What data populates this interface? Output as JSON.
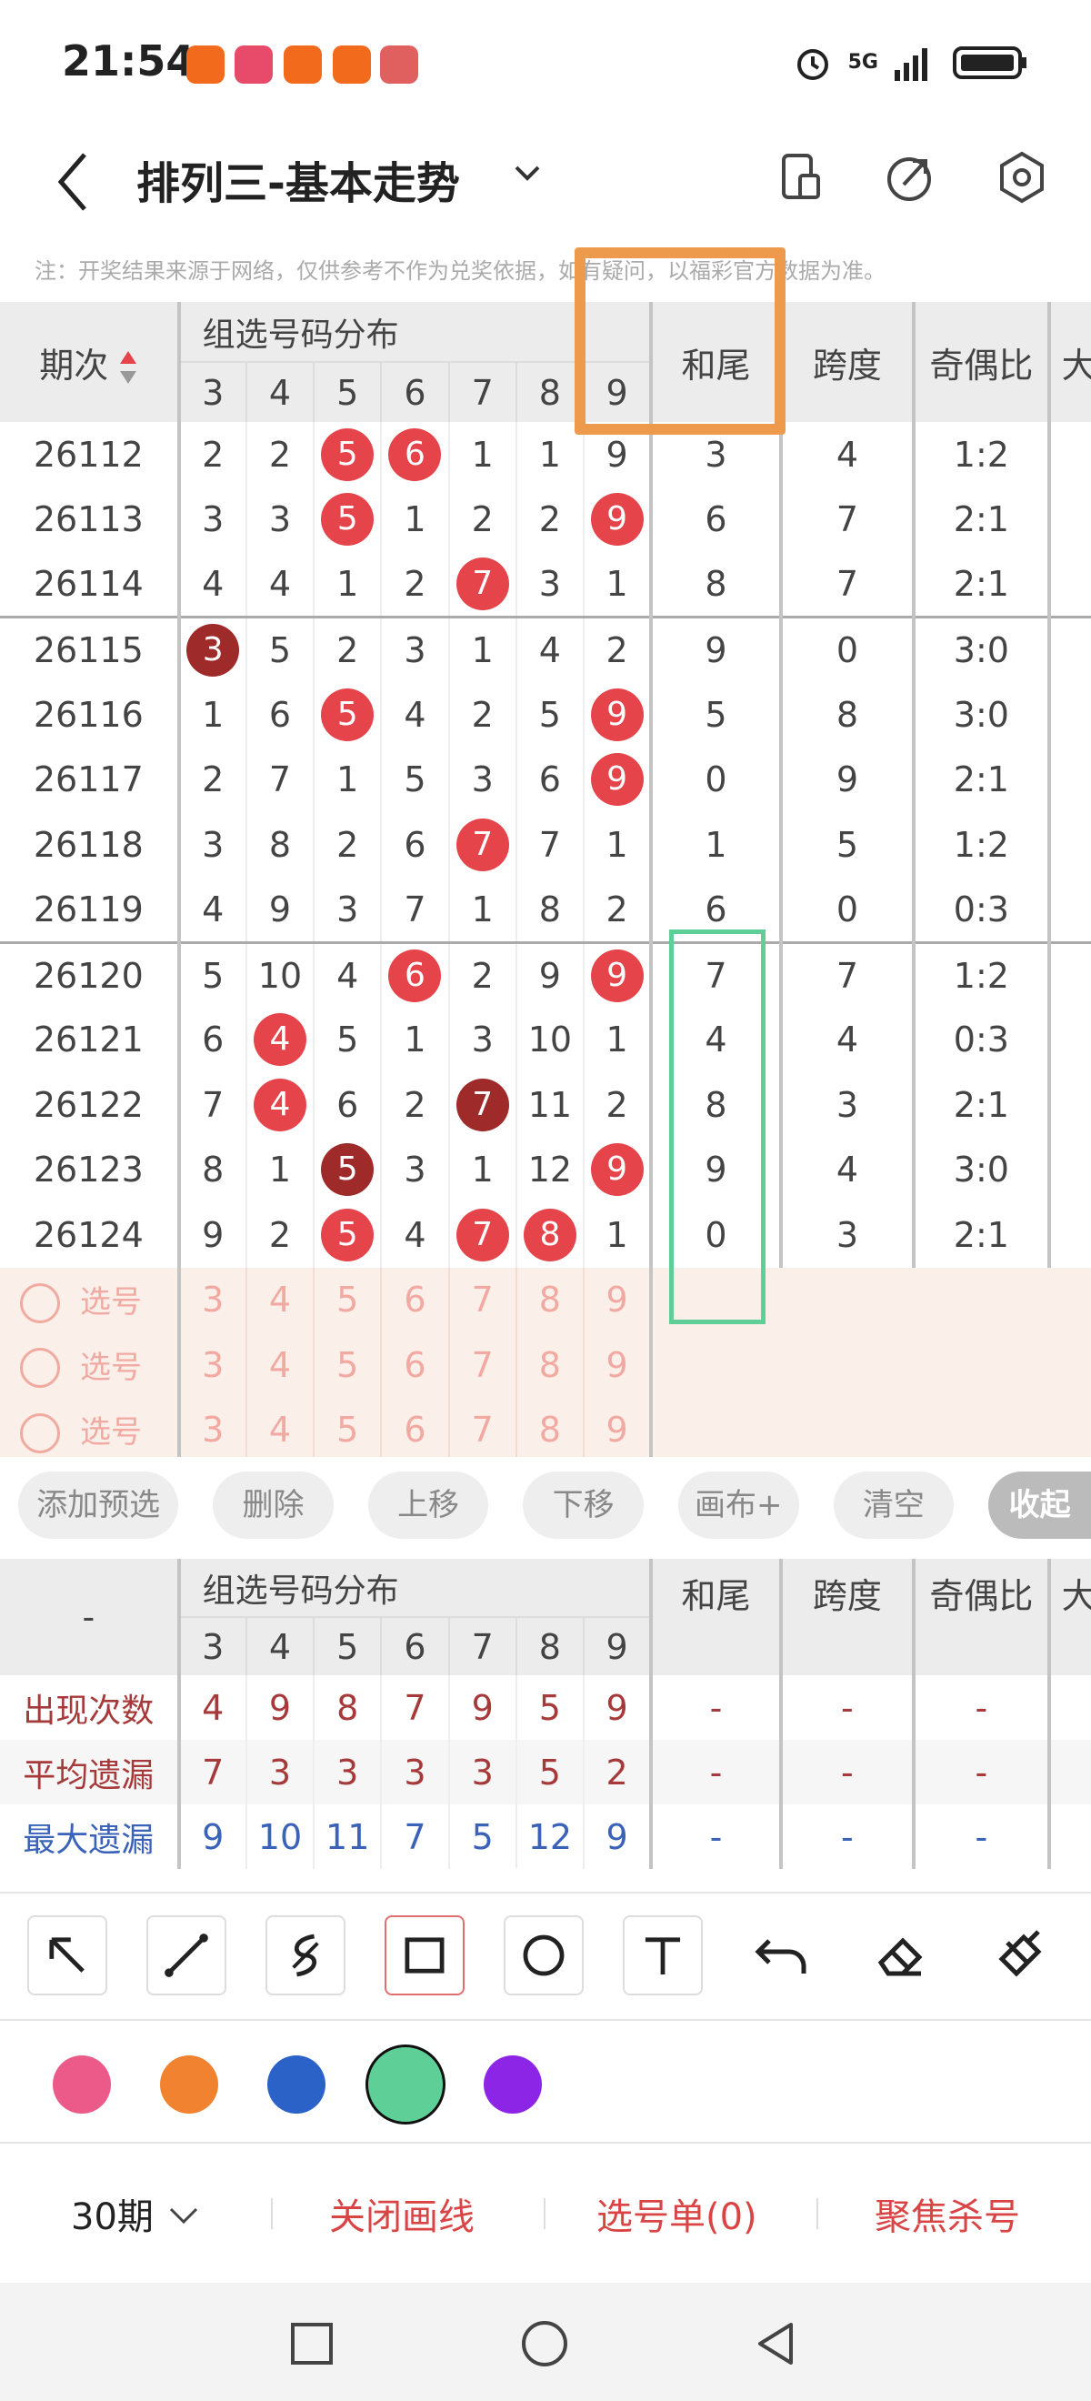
{
  "status_bar": {
    "time": "21:54",
    "network": "5G",
    "battery_icon": "battery-icon",
    "alarm_icon": "alarm-icon"
  },
  "header": {
    "title": "排列三-基本走势",
    "icons": [
      "back-icon",
      "chevron-down-icon",
      "phone-icon",
      "share-icon",
      "settings-icon"
    ]
  },
  "note": "注：开奖结果来源于网络，仅供参考不作为兑奖依据，如有疑问，以福彩官方数据为准。",
  "table": {
    "col_period": "期次",
    "col_group": "组选号码分布",
    "col_hewei": "和尾",
    "col_kuadu": "跨度",
    "col_jioubi": "奇偶比",
    "col_big": "大",
    "digits": [
      "3",
      "4",
      "5",
      "6",
      "7",
      "8",
      "9"
    ],
    "rows": [
      {
        "p": "26112",
        "c": [
          "2",
          "2",
          "5",
          "6",
          "1",
          "1",
          "9"
        ],
        "h": "3",
        "k": "4",
        "j": "1:2",
        "hit": [
          "",
          "",
          "r",
          "r",
          "",
          "",
          ""
        ]
      },
      {
        "p": "26113",
        "c": [
          "3",
          "3",
          "5",
          "1",
          "2",
          "2",
          "9"
        ],
        "h": "6",
        "k": "7",
        "j": "2:1",
        "hit": [
          "",
          "",
          "r",
          "",
          "",
          "",
          "r"
        ]
      },
      {
        "p": "26114",
        "c": [
          "4",
          "4",
          "1",
          "2",
          "7",
          "3",
          "1"
        ],
        "h": "8",
        "k": "7",
        "j": "2:1",
        "hit": [
          "",
          "",
          "",
          "",
          "r",
          "",
          ""
        ]
      },
      {
        "p": "26115",
        "c": [
          "3",
          "5",
          "2",
          "3",
          "1",
          "4",
          "2"
        ],
        "h": "9",
        "k": "0",
        "j": "3:0",
        "hit": [
          "d",
          "",
          "",
          "",
          "",
          "",
          ""
        ]
      },
      {
        "p": "26116",
        "c": [
          "1",
          "6",
          "5",
          "4",
          "2",
          "5",
          "9"
        ],
        "h": "5",
        "k": "8",
        "j": "3:0",
        "hit": [
          "",
          "",
          "r",
          "",
          "",
          "",
          "r"
        ]
      },
      {
        "p": "26117",
        "c": [
          "2",
          "7",
          "1",
          "5",
          "3",
          "6",
          "9"
        ],
        "h": "0",
        "k": "9",
        "j": "2:1",
        "hit": [
          "",
          "",
          "",
          "",
          "",
          "",
          "r"
        ]
      },
      {
        "p": "26118",
        "c": [
          "3",
          "8",
          "2",
          "6",
          "7",
          "7",
          "1"
        ],
        "h": "1",
        "k": "5",
        "j": "1:2",
        "hit": [
          "",
          "",
          "",
          "",
          "r",
          "",
          ""
        ]
      },
      {
        "p": "26119",
        "c": [
          "4",
          "9",
          "3",
          "7",
          "1",
          "8",
          "2"
        ],
        "h": "6",
        "k": "0",
        "j": "0:3",
        "hit": [
          "",
          "",
          "",
          "",
          "",
          "",
          ""
        ]
      },
      {
        "p": "26120",
        "c": [
          "5",
          "10",
          "4",
          "6",
          "2",
          "9",
          "9"
        ],
        "h": "7",
        "k": "7",
        "j": "1:2",
        "hit": [
          "",
          "",
          "",
          "r",
          "",
          "",
          "r"
        ]
      },
      {
        "p": "26121",
        "c": [
          "6",
          "4",
          "5",
          "1",
          "3",
          "10",
          "1"
        ],
        "h": "4",
        "k": "4",
        "j": "0:3",
        "hit": [
          "",
          "r",
          "",
          "",
          "",
          "",
          ""
        ]
      },
      {
        "p": "26122",
        "c": [
          "7",
          "4",
          "6",
          "2",
          "7",
          "11",
          "2"
        ],
        "h": "8",
        "k": "3",
        "j": "2:1",
        "hit": [
          "",
          "r",
          "",
          "",
          "d",
          "",
          ""
        ]
      },
      {
        "p": "26123",
        "c": [
          "8",
          "1",
          "5",
          "3",
          "1",
          "12",
          "9"
        ],
        "h": "9",
        "k": "4",
        "j": "3:0",
        "hit": [
          "",
          "",
          "d",
          "",
          "",
          "",
          "r"
        ]
      },
      {
        "p": "26124",
        "c": [
          "9",
          "2",
          "5",
          "4",
          "7",
          "8",
          "1"
        ],
        "h": "0",
        "k": "3",
        "j": "2:1",
        "hit": [
          "",
          "",
          "r",
          "",
          "r",
          "r",
          ""
        ]
      }
    ],
    "pick_label": "选号"
  },
  "buttons": [
    "添加预选",
    "删除",
    "上移",
    "下移",
    "画布+",
    "清空",
    "收起"
  ],
  "stats": {
    "dash": "-",
    "rows": [
      {
        "label": "出现次数",
        "v": [
          "4",
          "9",
          "8",
          "7",
          "9",
          "5",
          "9"
        ],
        "color": "#a63a3a"
      },
      {
        "label": "平均遗漏",
        "v": [
          "7",
          "3",
          "3",
          "3",
          "3",
          "5",
          "2"
        ],
        "color": "#a63a3a"
      },
      {
        "label": "最大遗漏",
        "v": [
          "9",
          "10",
          "11",
          "7",
          "5",
          "12",
          "9"
        ],
        "color": "#3a62b8"
      }
    ]
  },
  "draw_tools": [
    "arrow-tool-icon",
    "line-tool-icon",
    "curve-tool-icon",
    "rect-tool-icon",
    "circle-tool-icon",
    "text-tool-icon",
    "undo-icon",
    "eraser-icon",
    "brush-icon"
  ],
  "swatches": [
    "#ec5a8a",
    "#f08230",
    "#2a62c8",
    "#5ecf96",
    "#8d25e6"
  ],
  "bottom": {
    "period": "30期",
    "close_lines": "关闭画线",
    "pick_list": "选号单(0)",
    "focus_kill": "聚焦杀号"
  }
}
